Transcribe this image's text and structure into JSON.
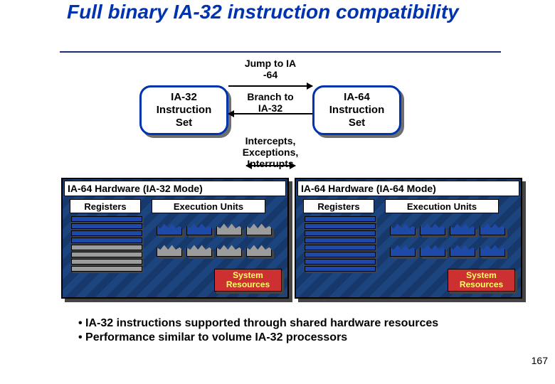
{
  "title": "Full binary IA-32 instruction compatibility",
  "instruction_boxes": {
    "left": "IA-32\nInstruction\nSet",
    "right": "IA-64\nInstruction\nSet"
  },
  "transitions": {
    "jump": "Jump to IA\n-64",
    "branch": "Branch to\nIA-32",
    "intercepts": "Intercepts,\nExceptions,\nInterrupts"
  },
  "hardware": {
    "left": {
      "title": "IA-64 Hardware (IA-32 Mode)",
      "registers_label": "Registers",
      "exec_label": "Execution Units",
      "sysres": "System\nResources",
      "active_registers": 4,
      "total_registers": 8,
      "active_exec_units": 2,
      "total_exec_units": 8
    },
    "right": {
      "title": "IA-64 Hardware (IA-64 Mode)",
      "registers_label": "Registers",
      "exec_label": "Execution Units",
      "sysres": "System\nResources",
      "active_registers": 8,
      "total_registers": 8,
      "active_exec_units": 8,
      "total_exec_units": 8
    }
  },
  "bullets": [
    "IA-32 instructions supported through shared hardware resources",
    "Performance similar to volume IA-32 processors"
  ],
  "page_number": "167",
  "colors": {
    "title_blue": "#0033B0",
    "panel_blue": "#1d4aa8",
    "inactive_gray": "#9c9c9c",
    "sysres_red": "#cc3030",
    "sysres_yellow": "#ffff66"
  }
}
